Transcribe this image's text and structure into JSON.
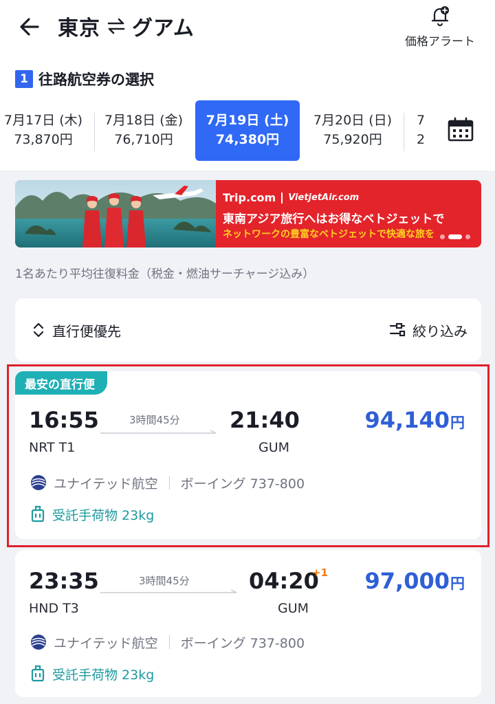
{
  "header": {
    "origin": "東京",
    "destination": "グアム",
    "alert_label": "価格アラート"
  },
  "step": {
    "number": "1",
    "title": "往路航空券の選択"
  },
  "dates": [
    {
      "date": "7月17日 (木)",
      "price": "73,870円",
      "selected": false
    },
    {
      "date": "7月18日 (金)",
      "price": "76,710円",
      "selected": false
    },
    {
      "date": "7月19日 (土)",
      "price": "74,380円",
      "selected": true
    },
    {
      "date": "7月20日 (日)",
      "price": "75,920円",
      "selected": false
    },
    {
      "date": "7",
      "price": "2",
      "selected": false
    }
  ],
  "banner": {
    "brand": "Trip.com",
    "partner": "VietjetAir.com",
    "line1": "東南アジア旅行へはお得なベトジェットで",
    "line2": "ネットワークの豊富なベトジェットで快適な旅を"
  },
  "price_note": "1名あたり平均往復料金（税金・燃油サーチャージ込み）",
  "filters": {
    "sort_label": "直行便優先",
    "filter_label": "絞り込み"
  },
  "flights": [
    {
      "tag": "最安の直行便",
      "depart_time": "16:55",
      "depart_airport": "NRT T1",
      "duration": "3時間45分",
      "arrive_time": "21:40",
      "arrive_airport": "GUM",
      "day_offset": "",
      "price": "94,140",
      "price_unit": "円",
      "airline": "ユナイテッド航空",
      "aircraft": "ボーイング 737-800",
      "baggage": "受託手荷物 23kg"
    },
    {
      "tag": "",
      "depart_time": "23:35",
      "depart_airport": "HND T3",
      "duration": "3時間45分",
      "arrive_time": "04:20",
      "arrive_airport": "GUM",
      "day_offset": "+1",
      "price": "97,000",
      "price_unit": "円",
      "airline": "ユナイテッド航空",
      "aircraft": "ボーイング 737-800",
      "baggage": "受託手荷物 23kg"
    }
  ],
  "colors": {
    "accent": "#2f69f5",
    "price": "#2f5fd6",
    "teal": "#1fb0b5",
    "highlight": "#e0202c",
    "banner_red": "#e3242b"
  },
  "icons": [
    "back-arrow-icon",
    "swap-arrows-icon",
    "bell-plus-icon",
    "calendar-icon",
    "sort-icon",
    "filter-icon",
    "airline-logo-icon",
    "luggage-icon"
  ]
}
